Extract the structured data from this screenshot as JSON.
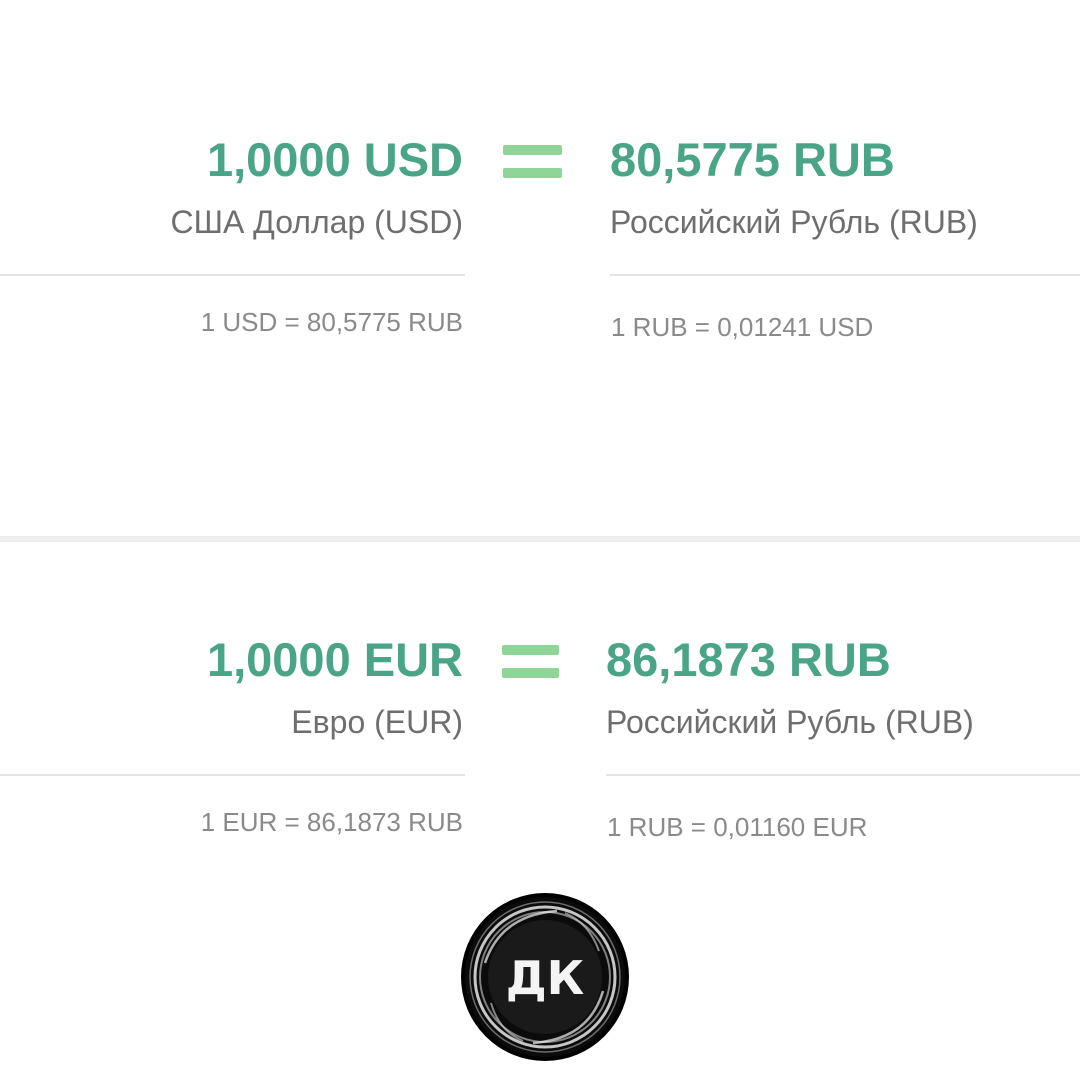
{
  "colors": {
    "amount": "#4aa487",
    "equals": "#8fd597",
    "name": "#6e6e6e",
    "rate": "#8a8a8a",
    "divider": "#e4e4e4"
  },
  "conversions": [
    {
      "from_amount": "1,0000 USD",
      "from_name": "США Доллар (USD)",
      "to_amount": "80,5775 RUB",
      "to_name": "Российский Рубль (RUB)",
      "rate_forward": "1 USD = 80,5775 RUB",
      "rate_inverse": "1 RUB = 0,01241 USD"
    },
    {
      "from_amount": "1,0000 EUR",
      "from_name": "Евро (EUR)",
      "to_amount": "86,1873 RUB",
      "to_name": "Российский Рубль (RUB)",
      "rate_forward": "1 EUR = 86,1873 RUB",
      "rate_inverse": "1 RUB = 0,01160 EUR"
    }
  ],
  "logo": {
    "text": "ДК",
    "icon": "dk-logo-icon"
  }
}
